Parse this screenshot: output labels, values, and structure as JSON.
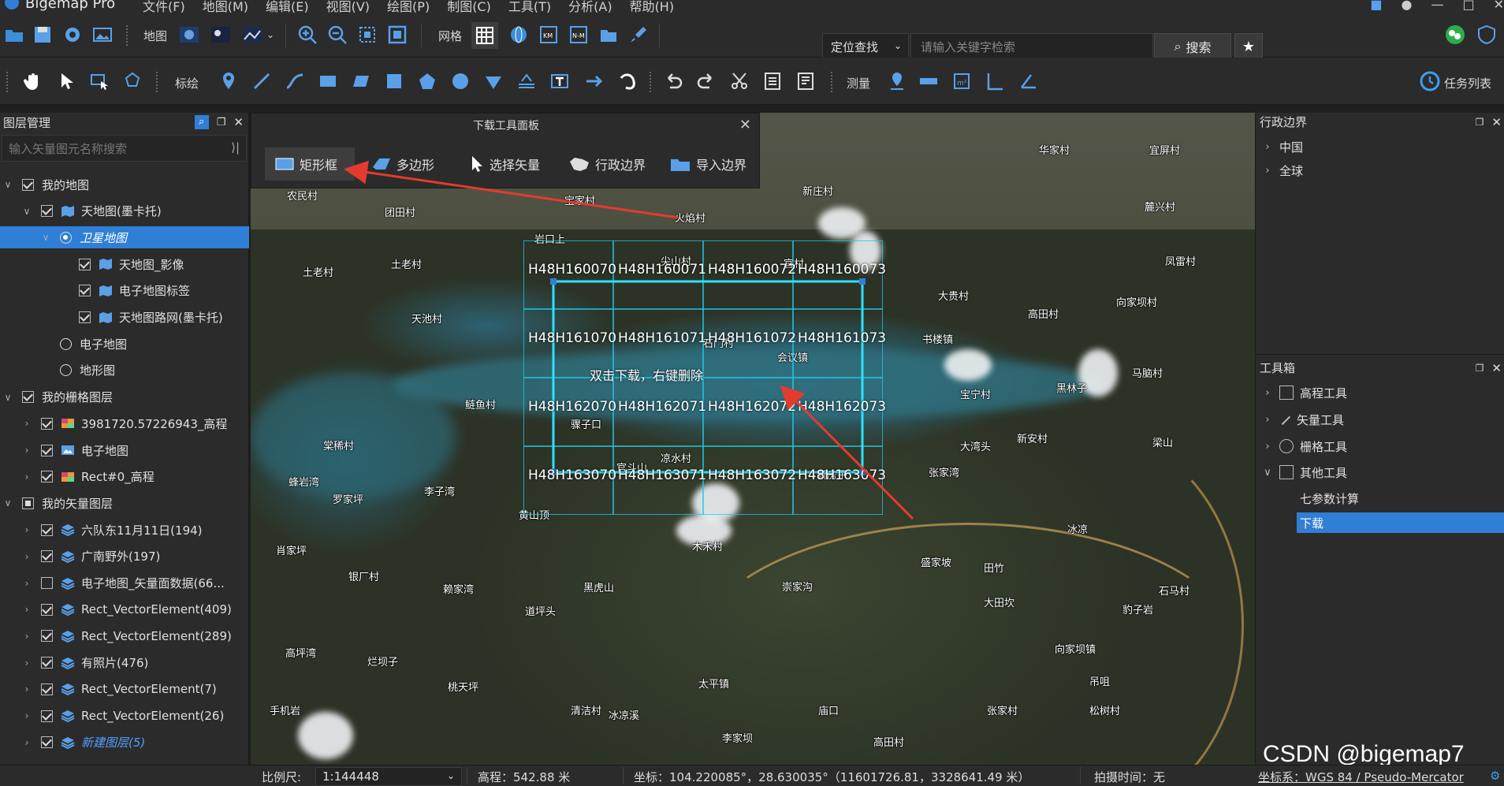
{
  "app": {
    "name": "Bigemap Pro"
  },
  "menu": [
    "文件(F)",
    "地图(M)",
    "编辑(E)",
    "视图(V)",
    "绘图(P)",
    "制图(C)",
    "工具(T)",
    "分析(A)",
    "帮助(H)"
  ],
  "toolbar1": {
    "map_label": "地图",
    "grid_label": "网格",
    "search_mode": "定位查找",
    "search_placeholder": "请输入关键字检索",
    "search_button": "搜索"
  },
  "toolbar2": {
    "annotate_label": "标绘",
    "measure_label": "测量",
    "task_list": "任务列表"
  },
  "layer_panel": {
    "title": "图层管理",
    "search_placeholder": "输入矢量图元名称搜索",
    "rows": [
      {
        "label": "我的地图",
        "level": 0,
        "arrow": "∨",
        "ctrl": "check",
        "icon": ""
      },
      {
        "label": "天地图(墨卡托)",
        "level": 1,
        "arrow": "∨",
        "ctrl": "check",
        "icon": "map"
      },
      {
        "label": "卫星地图",
        "level": 2,
        "arrow": "∨",
        "ctrl": "radio-on",
        "icon": "",
        "selected": true
      },
      {
        "label": "天地图_影像",
        "level": 3,
        "arrow": "",
        "ctrl": "check",
        "icon": "map"
      },
      {
        "label": "电子地图标签",
        "level": 3,
        "arrow": "",
        "ctrl": "check",
        "icon": "map"
      },
      {
        "label": "天地图路网(墨卡托)",
        "level": 3,
        "arrow": "",
        "ctrl": "check",
        "icon": "map"
      },
      {
        "label": "电子地图",
        "level": 2,
        "arrow": "",
        "ctrl": "radio",
        "icon": ""
      },
      {
        "label": "地形图",
        "level": 2,
        "arrow": "",
        "ctrl": "radio",
        "icon": ""
      },
      {
        "label": "我的栅格图层",
        "level": 0,
        "arrow": "∨",
        "ctrl": "check",
        "icon": ""
      },
      {
        "label": "3981720.57226943_高程",
        "level": 1,
        "arrow": "›",
        "ctrl": "check",
        "icon": "raster"
      },
      {
        "label": "电子地图",
        "level": 1,
        "arrow": "›",
        "ctrl": "check",
        "icon": "image"
      },
      {
        "label": "Rect#0_高程",
        "level": 1,
        "arrow": "›",
        "ctrl": "check",
        "icon": "raster"
      },
      {
        "label": "我的矢量图层",
        "level": 0,
        "arrow": "∨",
        "ctrl": "partial",
        "icon": ""
      },
      {
        "label": "六队东11月11日(194)",
        "level": 1,
        "arrow": "›",
        "ctrl": "check",
        "icon": "vector"
      },
      {
        "label": "广南野外(197)",
        "level": 1,
        "arrow": "›",
        "ctrl": "check",
        "icon": "vector"
      },
      {
        "label": "电子地图_矢量面数据(66...",
        "level": 1,
        "arrow": "›",
        "ctrl": "unchecked",
        "icon": "vector"
      },
      {
        "label": "Rect_VectorElement(409)",
        "level": 1,
        "arrow": "›",
        "ctrl": "check",
        "icon": "vector"
      },
      {
        "label": "Rect_VectorElement(289)",
        "level": 1,
        "arrow": "›",
        "ctrl": "check",
        "icon": "vector"
      },
      {
        "label": "有照片(476)",
        "level": 1,
        "arrow": "›",
        "ctrl": "check",
        "icon": "vector"
      },
      {
        "label": "Rect_VectorElement(7)",
        "level": 1,
        "arrow": "›",
        "ctrl": "check",
        "icon": "vector"
      },
      {
        "label": "Rect_VectorElement(26)",
        "level": 1,
        "arrow": "›",
        "ctrl": "check",
        "icon": "vector"
      },
      {
        "label": "新建图层(5)",
        "level": 1,
        "arrow": "›",
        "ctrl": "check",
        "icon": "vector",
        "italic_blue": true
      }
    ]
  },
  "download_panel": {
    "title": "下载工具面板",
    "buttons": [
      "矩形框",
      "多边形",
      "选择矢量",
      "行政边界",
      "导入边界"
    ]
  },
  "map": {
    "grid_labels": [
      [
        "H48H160070",
        "H48H160071",
        "H48H160072",
        "H48H160073"
      ],
      [
        "H48H161070",
        "H48H161071",
        "H48H161072",
        "H48H161073"
      ],
      [
        "H48H162070",
        "H48H162071",
        "H48H162072",
        "H48H162073"
      ],
      [
        "H48H163070",
        "H48H163071",
        "H48H163072",
        "H48H163073"
      ]
    ],
    "hint": "双击下载，右键删除",
    "places": [
      "农民村",
      "团田村",
      "宝家村",
      "火焰村",
      "新庄村",
      "华家村",
      "宜屏村",
      "麓兴村",
      "岩口上",
      "土老村",
      "土老村",
      "尖山村",
      "官村",
      "凤雷村",
      "大贵村",
      "高田村",
      "向家坝村",
      "天池村",
      "石门村",
      "会议镇",
      "书楼镇",
      "黑林子",
      "马脑村",
      "宝宁村",
      "鲢鱼村",
      "骤子口",
      "棠稀村",
      "凉水村",
      "蜂岩湾",
      "罗家坪",
      "李子湾",
      "大湾头",
      "新安村",
      "梁山",
      "黄山顶",
      "官斗山",
      "新房子",
      "张家湾",
      "木禾村",
      "肖家坪",
      "银厂村",
      "赖家湾",
      "黑虎山",
      "崇家沟",
      "盛家坡",
      "田竹",
      "冰凉",
      "石马村",
      "道坪头",
      "大田坎",
      "豹子岩",
      "高坪湾",
      "烂坝子",
      "桃天坪",
      "太平镇",
      "向家坝镇",
      "吊咀",
      "手机岩",
      "清洁村",
      "冰凉溪",
      "庙口",
      "张家村",
      "松树村",
      "李家坝",
      "高田村"
    ]
  },
  "right_panel": {
    "admin_title": "行政边界",
    "admin_items": [
      "中国",
      "全球"
    ],
    "toolbox_title": "工具箱",
    "toolbox_items": [
      {
        "label": "高程工具",
        "arrow": "›"
      },
      {
        "label": "矢量工具",
        "arrow": "›"
      },
      {
        "label": "栅格工具",
        "arrow": "›"
      },
      {
        "label": "其他工具",
        "arrow": "∨"
      }
    ],
    "sub_items": [
      "七参数计算",
      "下载"
    ]
  },
  "status": {
    "scale_label": "比例尺:",
    "scale_value": "1:144448",
    "elevation": "高程：542.88 米",
    "coords": "坐标：104.220085°，28.630035°（11601726.81，3328641.49 米）",
    "capture_time": "拍摄时间：无",
    "crs": "坐标系：WGS 84 / Pseudo-Mercator"
  },
  "watermark": "CSDN @bigemap7",
  "colors": {
    "accent": "#2f7fd6",
    "grid": "#1ec8e8",
    "arrow": "#e33b2e"
  }
}
